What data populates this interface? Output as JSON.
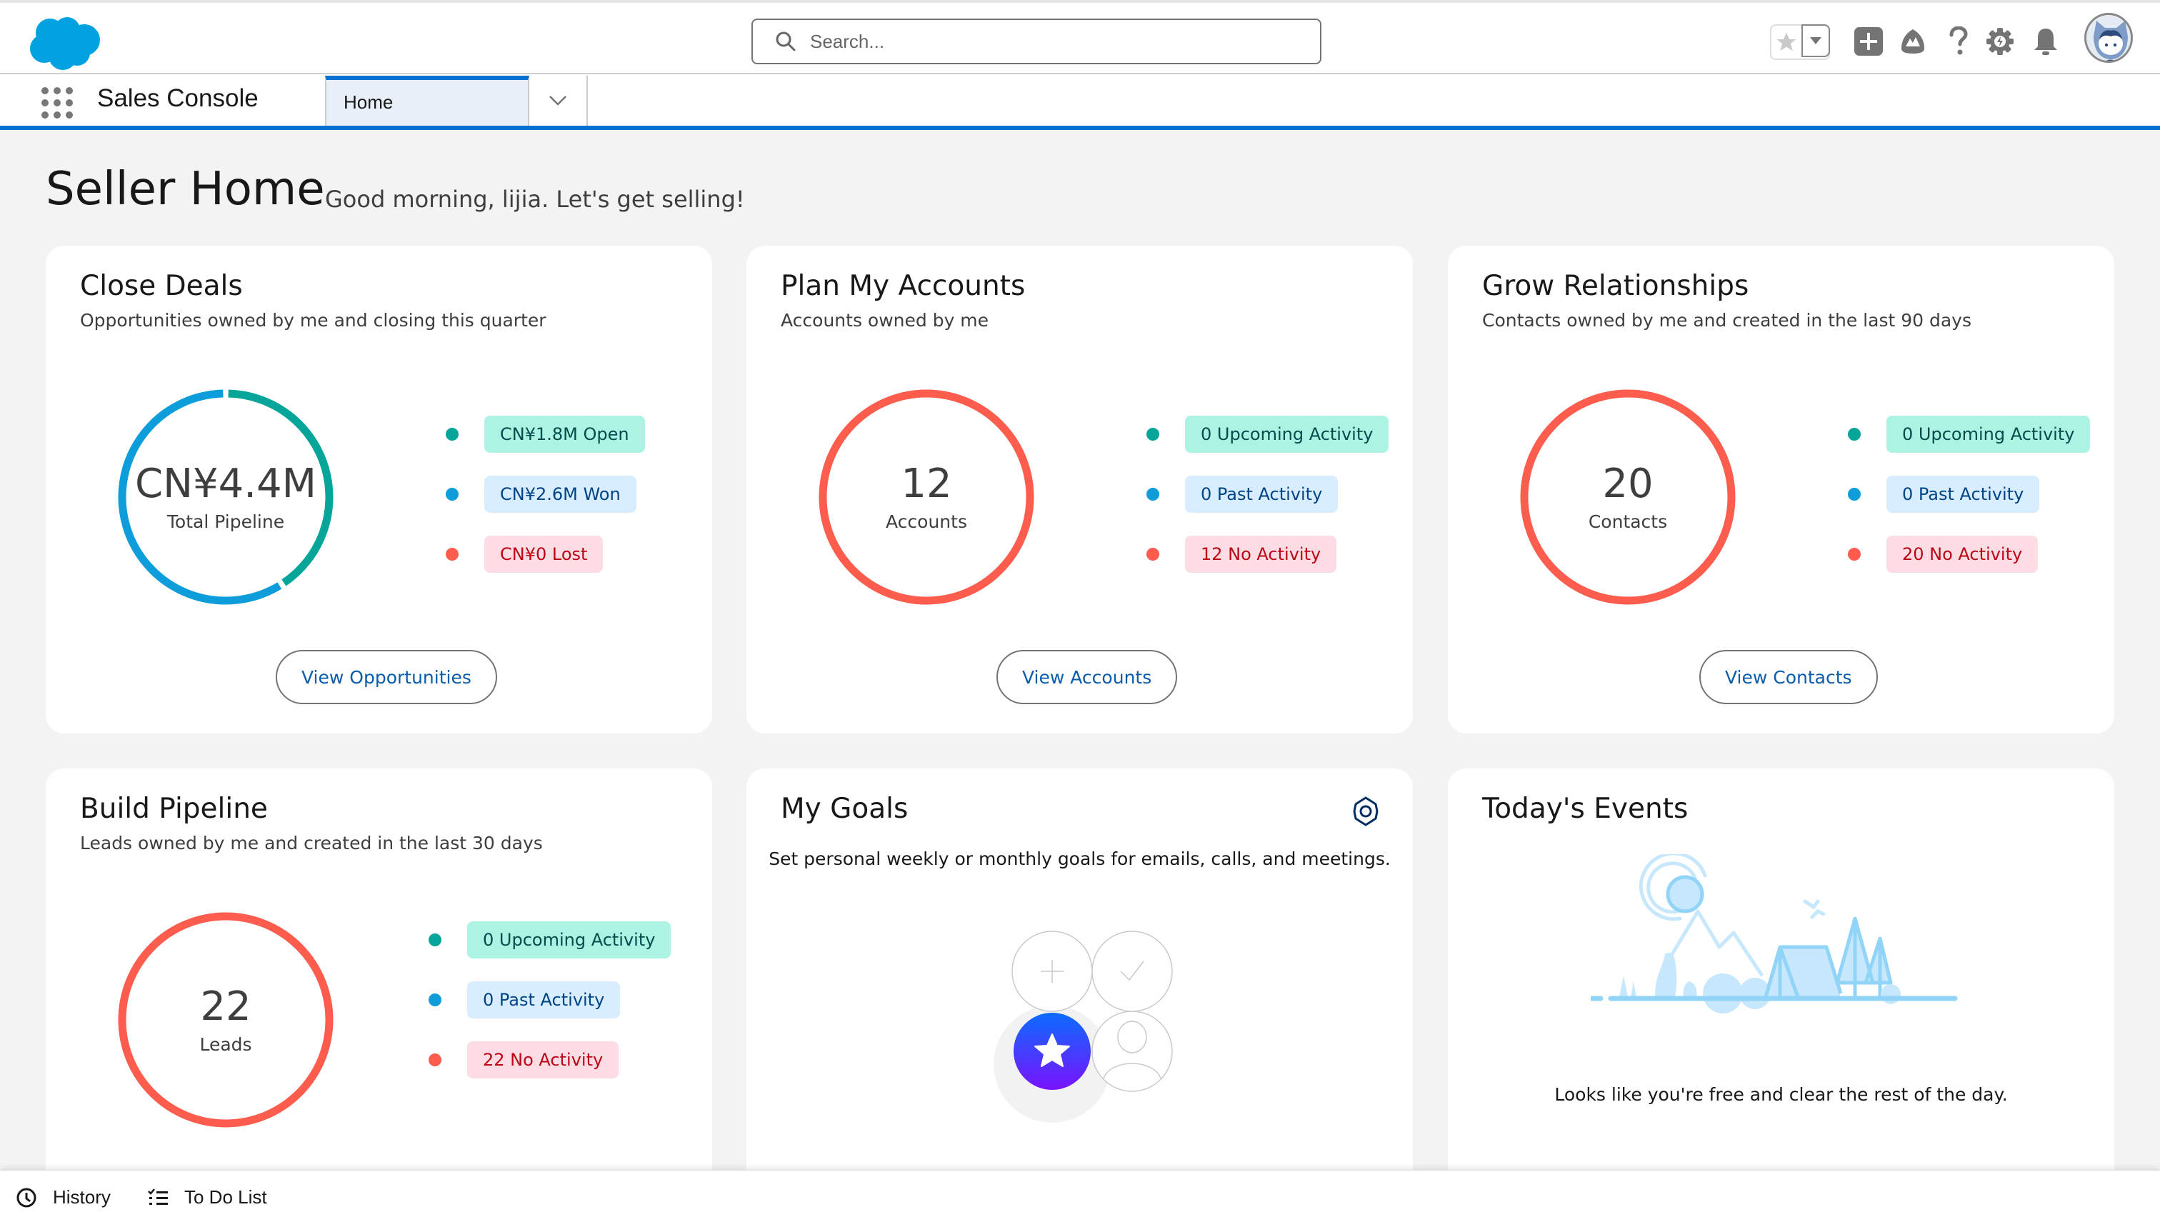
{
  "header": {
    "search_placeholder": "Search...",
    "icons": [
      "salesforce-cloud-logo",
      "favorites-star-icon",
      "favorites-dropdown-icon",
      "global-actions-plus-icon",
      "trailhead-icon",
      "help-icon",
      "setup-gear-icon",
      "notifications-bell-icon",
      "user-avatar"
    ]
  },
  "nav": {
    "app_name": "Sales Console",
    "tabs": [
      {
        "label": "Home",
        "active": true
      }
    ]
  },
  "page": {
    "title": "Seller Home",
    "greeting": "Good morning, lijia. Let's get selling!"
  },
  "colors": {
    "brand": "#0070d2",
    "teal": "#06a59a",
    "blue": "#0d9dda",
    "red": "#fe5c4c"
  },
  "cards": {
    "close_deals": {
      "title": "Close Deals",
      "subtitle": "Opportunities owned by me and closing this quarter",
      "ring_value": "CN¥4.4M",
      "ring_label": "Total Pipeline",
      "segments": {
        "open": 1.8,
        "won": 2.6,
        "lost": 0
      },
      "legend": [
        {
          "label": "CN¥1.8M Open",
          "color": "teal"
        },
        {
          "label": "CN¥2.6M Won",
          "color": "blue"
        },
        {
          "label": "CN¥0 Lost",
          "color": "red"
        }
      ],
      "button": "View Opportunities"
    },
    "plan_accounts": {
      "title": "Plan My Accounts",
      "subtitle": "Accounts owned by me",
      "ring_value": "12",
      "ring_label": "Accounts",
      "legend": [
        {
          "label": "0 Upcoming Activity",
          "color": "teal"
        },
        {
          "label": "0 Past Activity",
          "color": "blue"
        },
        {
          "label": "12 No Activity",
          "color": "red"
        }
      ],
      "button": "View Accounts"
    },
    "grow_relationships": {
      "title": "Grow Relationships",
      "subtitle": "Contacts owned by me and created in the last 90 days",
      "ring_value": "20",
      "ring_label": "Contacts",
      "legend": [
        {
          "label": "0 Upcoming Activity",
          "color": "teal"
        },
        {
          "label": "0 Past Activity",
          "color": "blue"
        },
        {
          "label": "20 No Activity",
          "color": "red"
        }
      ],
      "button": "View Contacts"
    },
    "build_pipeline": {
      "title": "Build Pipeline",
      "subtitle": "Leads owned by me and created in the last 30 days",
      "ring_value": "22",
      "ring_label": "Leads",
      "legend": [
        {
          "label": "0 Upcoming Activity",
          "color": "teal"
        },
        {
          "label": "0 Past Activity",
          "color": "blue"
        },
        {
          "label": "22 No Activity",
          "color": "red"
        }
      ]
    },
    "my_goals": {
      "title": "My Goals",
      "text": "Set personal weekly or monthly goals for emails, calls, and meetings."
    },
    "todays_events": {
      "title": "Today's Events",
      "text": "Looks like you're free and clear the rest of the day."
    }
  },
  "utility_bar": {
    "items": [
      {
        "label": "History",
        "icon": "clock-icon"
      },
      {
        "label": "To Do List",
        "icon": "checklist-icon"
      }
    ]
  }
}
